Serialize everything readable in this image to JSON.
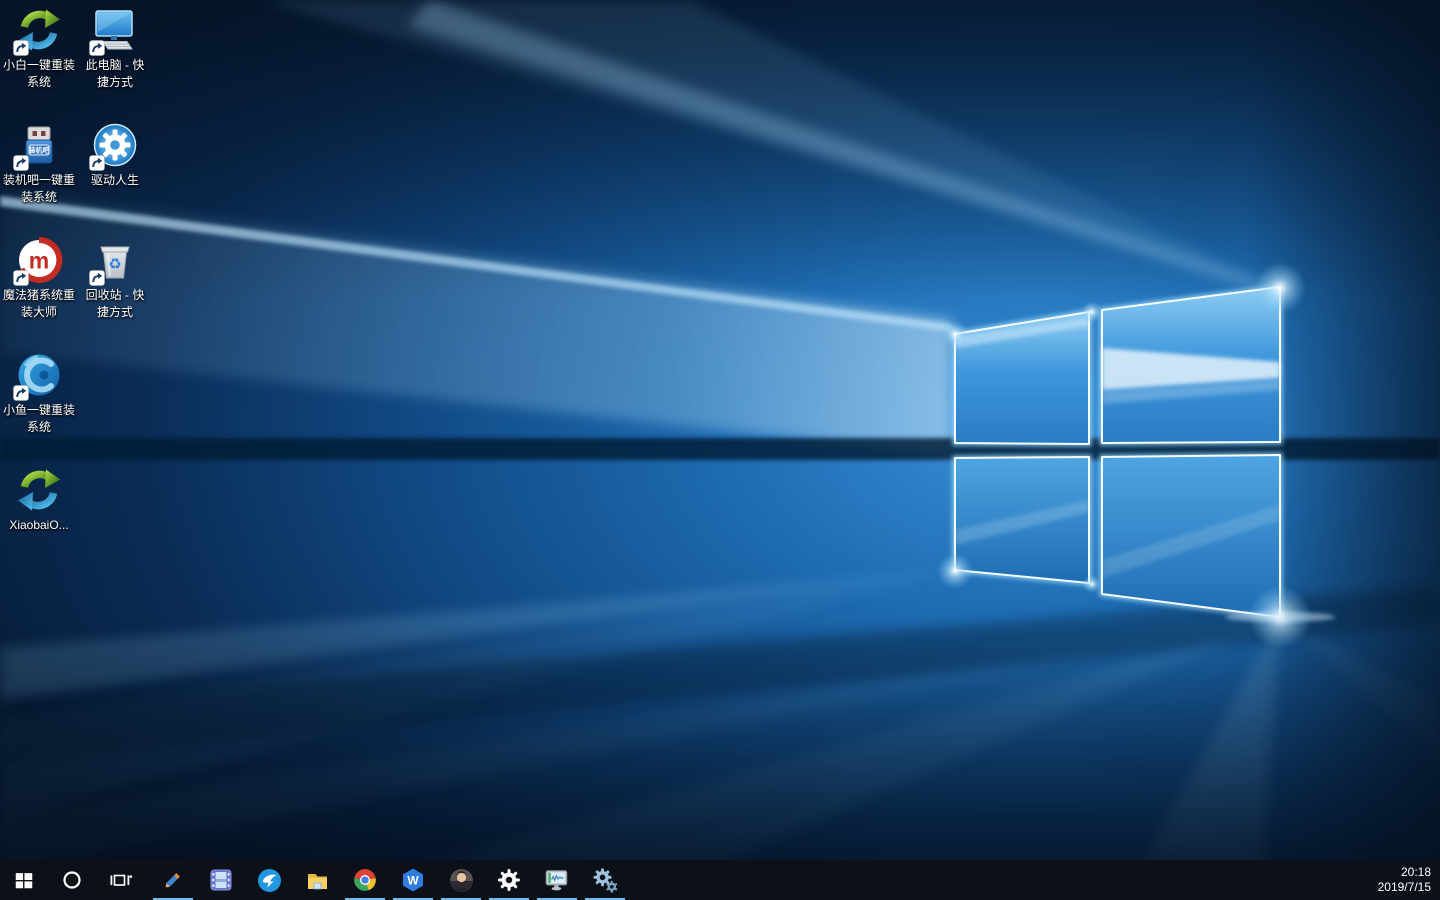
{
  "desktop": {
    "icons": [
      {
        "name": "xiaobai-one-key-reinstall",
        "icon": "refresh-arrows-icon",
        "line1": "小白一键重装",
        "line2": "系统",
        "shortcut": true
      },
      {
        "name": "this-pc-shortcut",
        "icon": "computer-icon",
        "line1": "此电脑 - 快",
        "line2": "捷方式",
        "shortcut": true
      },
      {
        "name": "zhuangjiba-one-key-reinstall",
        "icon": "usb-drive-icon",
        "line1": "装机吧一键重",
        "line2": "装系统",
        "shortcut": true,
        "usb_label": "装机吧"
      },
      {
        "name": "driver-life",
        "icon": "blue-gear-icon",
        "line1": "驱动人生",
        "line2": "",
        "shortcut": true
      },
      {
        "name": "mofazhu-system-reinstall-master",
        "icon": "red-m-icon",
        "line1": "魔法猪系统重",
        "line2": "装大师",
        "shortcut": true,
        "logo_letter": "m"
      },
      {
        "name": "recycle-bin-shortcut",
        "icon": "recycle-bin-icon",
        "line1": "回收站 - 快",
        "line2": "捷方式",
        "shortcut": true,
        "recycle_glyph": "♻"
      },
      {
        "name": "xiaoyu-one-key-reinstall",
        "icon": "blue-swirl-icon",
        "line1": "小鱼一键重装",
        "line2": "系统",
        "shortcut": true
      },
      {
        "name": "xiaobai-online",
        "icon": "refresh-arrows-icon",
        "line1": "XiaobaiO...",
        "line2": "",
        "shortcut": false
      }
    ]
  },
  "taskbar": {
    "apps": [
      {
        "name": "taskbar-pencil-app",
        "running": true
      },
      {
        "name": "taskbar-video-app",
        "running": false
      },
      {
        "name": "taskbar-dingtalk-app",
        "running": false
      },
      {
        "name": "taskbar-file-explorer",
        "running": false
      },
      {
        "name": "taskbar-chrome",
        "running": true
      },
      {
        "name": "taskbar-wps",
        "running": true,
        "logo_letter": "W"
      },
      {
        "name": "taskbar-user-app",
        "running": true
      },
      {
        "name": "taskbar-settings",
        "running": true
      },
      {
        "name": "taskbar-monitor-app",
        "running": true
      },
      {
        "name": "taskbar-gears-app",
        "running": true
      }
    ],
    "clock": {
      "time": "20:18",
      "date": "2019/7/15"
    },
    "colors": {
      "background": "#0c1119",
      "running_indicator": "#76b9e8"
    }
  }
}
